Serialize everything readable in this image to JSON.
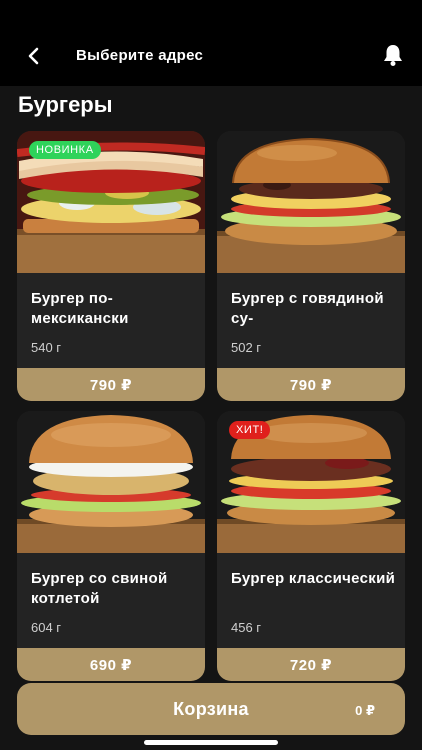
{
  "header": {
    "address": "Выберите адрес",
    "back_icon": "chevron-left-icon",
    "bell_icon": "bell-icon"
  },
  "section": {
    "title": "Бургеры"
  },
  "products": [
    {
      "name": "Бургер по-мексикански",
      "weight": "540 г",
      "price": "790 ₽",
      "badge": "НОВИНКА",
      "badge_color": "#2fd35a"
    },
    {
      "name": "Бургер с говядиной су-",
      "weight": "502 г",
      "price": "790 ₽",
      "badge": "",
      "badge_color": ""
    },
    {
      "name": "Бургер со свиной котлетой",
      "weight": "604 г",
      "price": "690 ₽",
      "badge": "",
      "badge_color": ""
    },
    {
      "name": "Бургер классический",
      "weight": "456 г",
      "price": "720 ₽",
      "badge": "ХИТ!",
      "badge_color": "#e0201c"
    }
  ],
  "cart": {
    "label": "Корзина",
    "total": "0 ₽"
  },
  "colors": {
    "accent": "#b09768",
    "background": "#141414",
    "card": "#232323"
  }
}
